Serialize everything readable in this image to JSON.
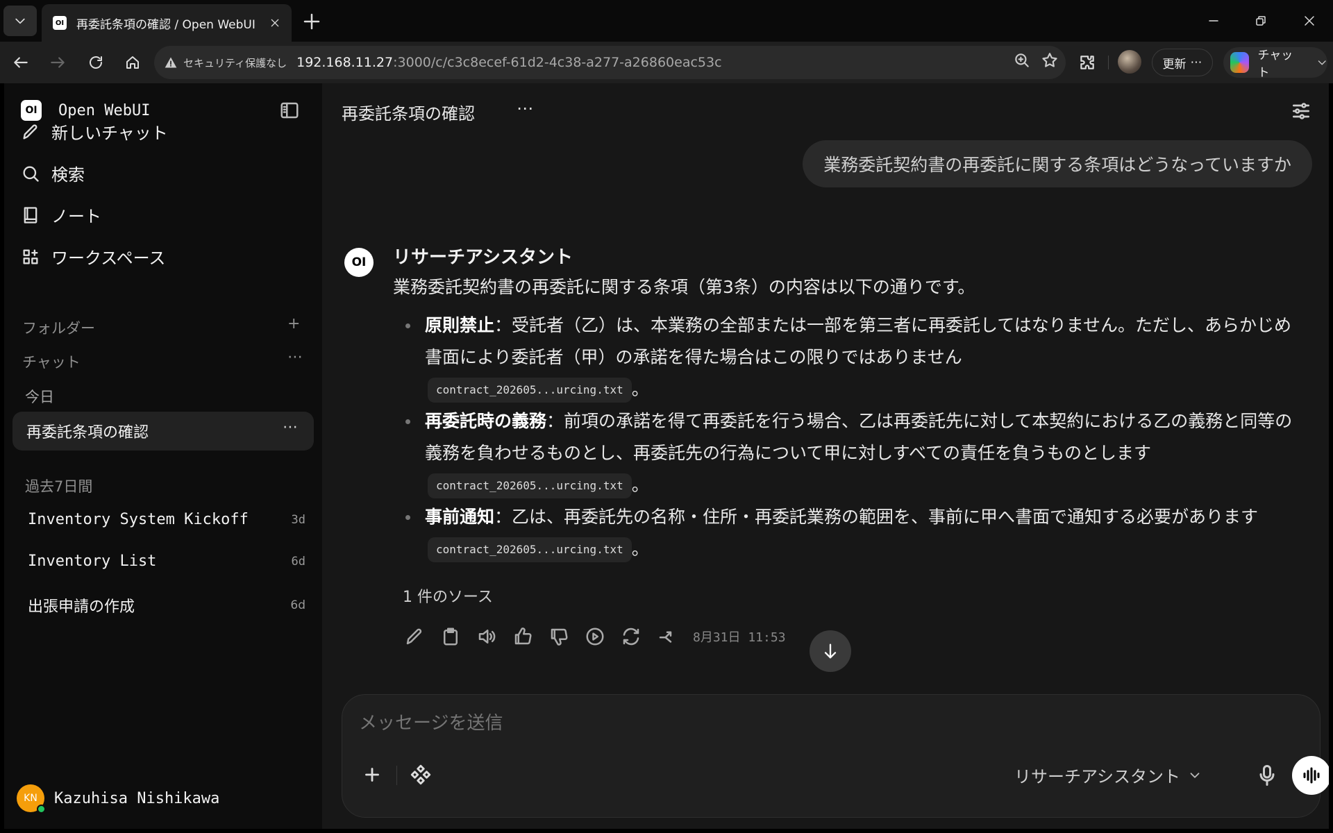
{
  "browser": {
    "tab_title": "再委託条項の確認 / Open WebUI",
    "tab_favicon_text": "OI",
    "security_label": "セキュリティ保護なし",
    "url_host": "192.168.11.27",
    "url_rest": ":3000/c/c3c8ecef-61d2-4c38-a277-a26860eac53c",
    "update_label": "更新",
    "copilot_label": "チャット"
  },
  "sidebar": {
    "logo_text": "OI",
    "app_name": "Open WebUI",
    "nav": [
      {
        "label": "新しいチャット",
        "icon": "pencil-icon"
      },
      {
        "label": "検索",
        "icon": "search-icon"
      },
      {
        "label": "ノート",
        "icon": "notebook-icon"
      },
      {
        "label": "ワークスペース",
        "icon": "grid-icon"
      }
    ],
    "folders_label": "フォルダー",
    "chats_label": "チャット",
    "today_label": "今日",
    "active_chat": "再委託条項の確認",
    "past7_label": "過去7日間",
    "past_chats": [
      {
        "title": "Inventory System Kickoff",
        "age": "3d"
      },
      {
        "title": "Inventory List",
        "age": "6d"
      },
      {
        "title": "出張申請の作成",
        "age": "6d"
      }
    ],
    "user": {
      "initials": "KN",
      "name": "Kazuhisa Nishikawa"
    }
  },
  "main": {
    "title": "再委託条項の確認",
    "user_message": "業務委託契約書の再委託に関する条項はどうなっていますか",
    "assistant": {
      "avatar_text": "OI",
      "name": "リサーチアシスタント",
      "intro": "業務委託契約書の再委託に関する条項（第3条）の内容は以下の通りです。",
      "bullets": [
        {
          "heading": "原則禁止",
          "text": "：受託者（乙）は、本業務の全部または一部を第三者に再委託してはなりません。ただし、あらかじめ書面により委託者（甲）の承諾を得た場合はこの限りではありません",
          "citation": "contract_202605...urcing.txt",
          "end": "。"
        },
        {
          "heading": "再委託時の義務",
          "text": "：前項の承諾を得て再委託を行う場合、乙は再委託先に対して本契約における乙の義務と同等の義務を負わせるものとし、再委託先の行為について甲に対しすべての責任を負うものとします",
          "citation": "contract_202605...urcing.txt",
          "end": "。"
        },
        {
          "heading": "事前通知",
          "text": "：乙は、再委託先の名称・住所・再委託業務の範囲を、事前に甲へ書面で通知する必要があります",
          "citation": "contract_202605...urcing.txt",
          "end": "。"
        }
      ],
      "sources_label": "1 件のソース",
      "timestamp": "8月31日 11:53"
    },
    "composer": {
      "placeholder": "メッセージを送信",
      "model": "リサーチアシスタント"
    }
  }
}
